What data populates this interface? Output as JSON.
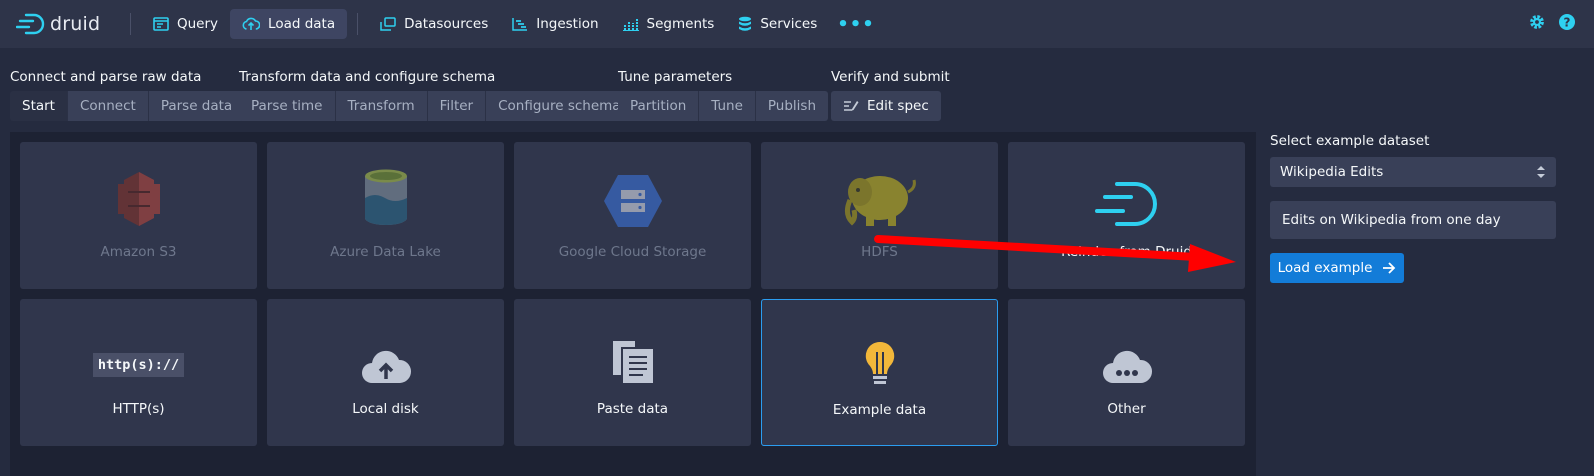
{
  "nav": {
    "logo_text": "druid",
    "items": [
      {
        "label": "Query"
      },
      {
        "label": "Load data"
      },
      {
        "label": "Datasources"
      },
      {
        "label": "Ingestion"
      },
      {
        "label": "Segments"
      },
      {
        "label": "Services"
      }
    ],
    "more_label": "•••"
  },
  "steps": [
    {
      "title": "Connect and parse raw data",
      "tabs": [
        "Start",
        "Connect",
        "Parse data"
      ]
    },
    {
      "title": "Transform data and configure schema",
      "tabs": [
        "Parse time",
        "Transform",
        "Filter",
        "Configure schema"
      ]
    },
    {
      "title": "Tune parameters",
      "tabs": [
        "Partition",
        "Tune",
        "Publish"
      ]
    },
    {
      "title": "Verify and submit",
      "tabs": [
        "Edit spec"
      ]
    }
  ],
  "active_step": "Start",
  "tiles": [
    {
      "label": "Amazon S3",
      "disabled": true
    },
    {
      "label": "Azure Data Lake",
      "disabled": true
    },
    {
      "label": "Google Cloud Storage",
      "disabled": true
    },
    {
      "label": "HDFS",
      "disabled": true
    },
    {
      "label": "Reindex from Druid",
      "disabled": false
    },
    {
      "label": "HTTP(s)",
      "disabled": false
    },
    {
      "label": "Local disk",
      "disabled": false
    },
    {
      "label": "Paste data",
      "disabled": false
    },
    {
      "label": "Example data",
      "selected": true
    },
    {
      "label": "Other",
      "disabled": false
    }
  ],
  "http_badge": "http(s)://",
  "panel": {
    "select_label": "Select example dataset",
    "selected_dataset": "Wikipedia Edits",
    "description": "Edits on Wikipedia from one day",
    "load_button": "Load example"
  },
  "colors": {
    "accent": "#2ed0f0",
    "primary_button": "#137cd8",
    "selection_border": "#2b9df0",
    "annotation_arrow": "#ff0000"
  }
}
